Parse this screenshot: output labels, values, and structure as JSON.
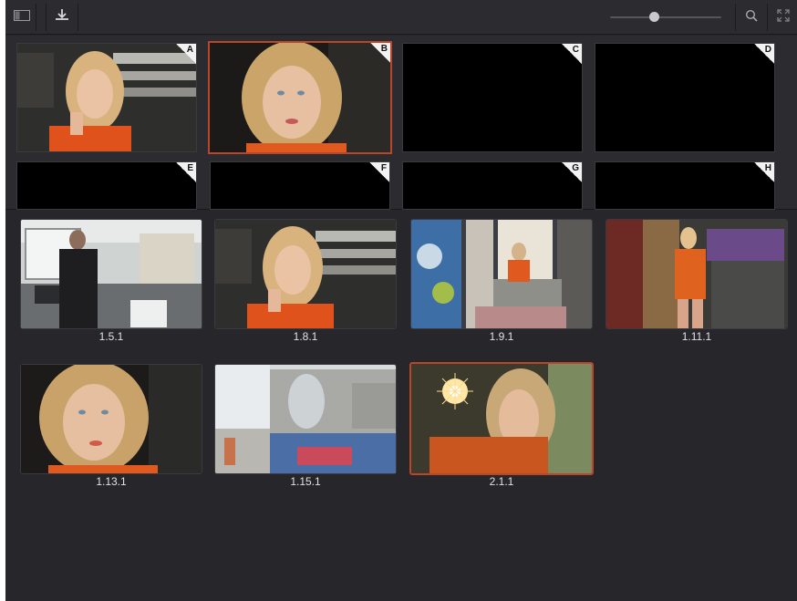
{
  "toolbar": {
    "sidebar_toggle_icon": "sidebar-panel-icon",
    "import_icon": "import-download-icon",
    "zoom_slider": {
      "value": 0.36
    },
    "search_icon": "search-icon",
    "expand_icon": "expand-fullscreen-icon"
  },
  "memories": [
    {
      "letter": "A",
      "state": "filled-woman-phone"
    },
    {
      "letter": "B",
      "state": "filled-woman-closeup",
      "selected": true
    },
    {
      "letter": "C",
      "state": "empty"
    },
    {
      "letter": "D",
      "state": "empty"
    },
    {
      "letter": "E",
      "state": "empty"
    },
    {
      "letter": "F",
      "state": "empty"
    },
    {
      "letter": "G",
      "state": "empty"
    },
    {
      "letter": "H",
      "state": "empty"
    }
  ],
  "clips": [
    {
      "label": "1.5.1",
      "scene": "man-in-studio"
    },
    {
      "label": "1.8.1",
      "scene": "woman-phone"
    },
    {
      "label": "1.9.1",
      "scene": "woman-graffiti-balcony"
    },
    {
      "label": "1.11.1",
      "scene": "woman-orange-suit-room"
    },
    {
      "label": "1.13.1",
      "scene": "woman-closeup"
    },
    {
      "label": "1.15.1",
      "scene": "graffiti-mural-wall"
    },
    {
      "label": "2.1.1",
      "scene": "woman-sparkler",
      "selected": true
    }
  ],
  "colors": {
    "accent_selected": "#b8462b",
    "panel_bg": "#2b2b30",
    "grid_bg": "#26262b"
  }
}
